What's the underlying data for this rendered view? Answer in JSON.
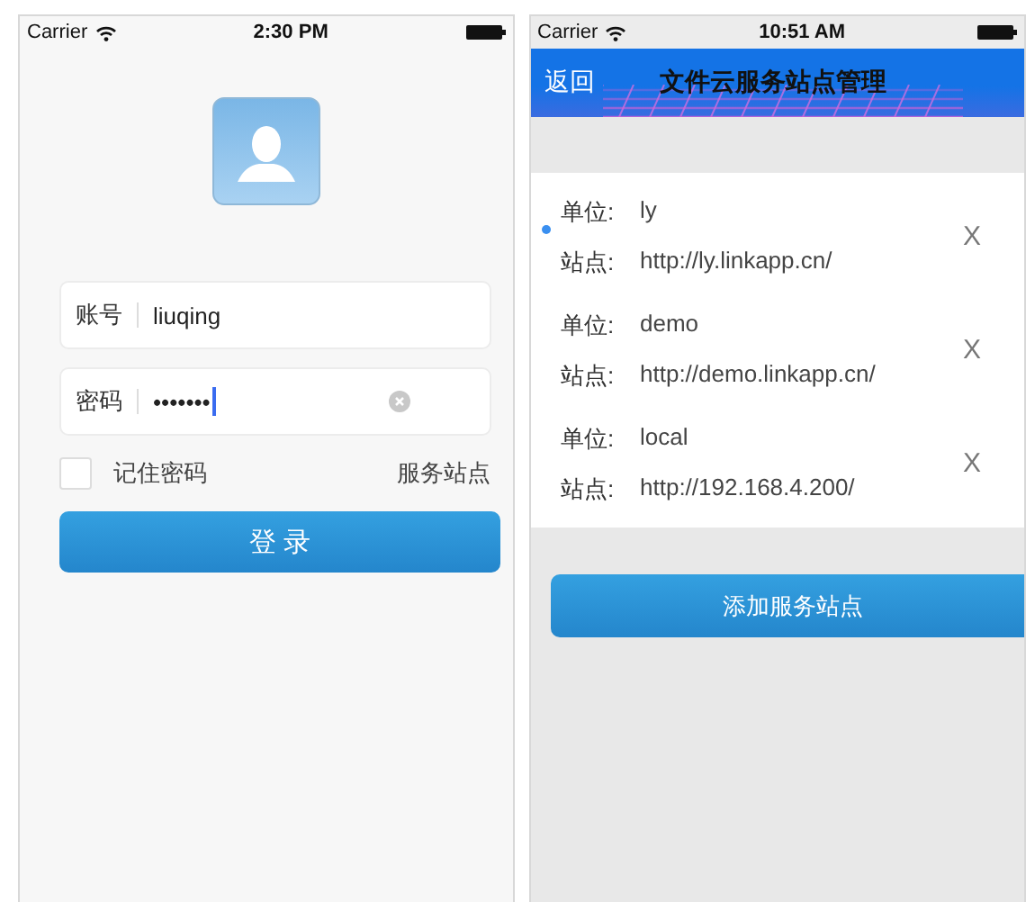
{
  "login_screen": {
    "status_bar": {
      "carrier": "Carrier",
      "time": "2:30 PM"
    },
    "account_field": {
      "label": "账号",
      "value": "liuqing"
    },
    "password_field": {
      "label": "密码",
      "value": "•••••••"
    },
    "remember_password": {
      "label": "记住密码",
      "checked": false
    },
    "service_site_link": "服务站点",
    "login_button": "登 录"
  },
  "sites_screen": {
    "status_bar": {
      "carrier": "Carrier",
      "time": "10:51 AM"
    },
    "nav_bar": {
      "back": "返回",
      "title": "文件云服务站点管理"
    },
    "sites": [
      {
        "unit_label": "单位:",
        "unit": "ly",
        "site_label": "站点:",
        "url": "http://ly.linkapp.cn/",
        "selected": true,
        "delete": "X"
      },
      {
        "unit_label": "单位:",
        "unit": "demo",
        "site_label": "站点:",
        "url": "http://demo.linkapp.cn/",
        "selected": false,
        "delete": "X"
      },
      {
        "unit_label": "单位:",
        "unit": "local",
        "site_label": "站点:",
        "url": "http://192.168.4.200/",
        "selected": false,
        "delete": "X"
      }
    ],
    "add_button": "添加服务站点"
  }
}
